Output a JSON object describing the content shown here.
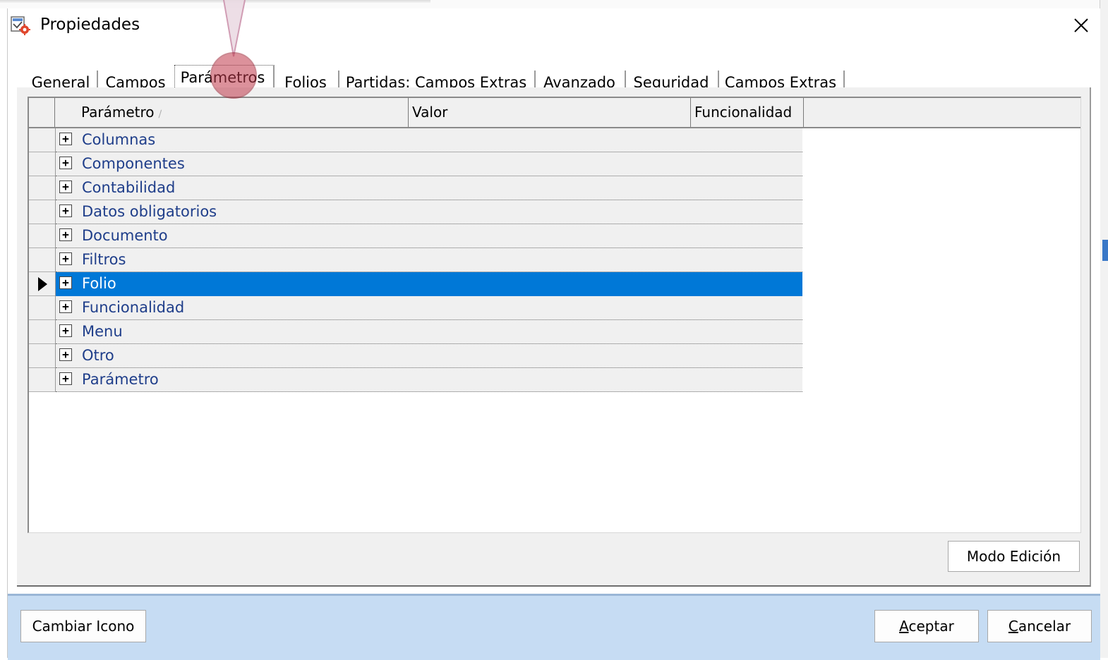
{
  "window": {
    "title": "Propiedades"
  },
  "tabs": [
    {
      "label": "General"
    },
    {
      "label": "Campos"
    },
    {
      "label": "Parámetros",
      "active": true
    },
    {
      "label": "Folios"
    },
    {
      "label": "Partidas: Campos Extras"
    },
    {
      "label": "Avanzado"
    },
    {
      "label": "Seguridad"
    },
    {
      "label": "Campos Extras"
    }
  ],
  "grid": {
    "columns": [
      {
        "label": "Parámetro",
        "sorted": "ascending"
      },
      {
        "label": "Valor"
      },
      {
        "label": "Funcionalidad"
      }
    ],
    "rows": [
      {
        "label": "Columnas"
      },
      {
        "label": "Componentes"
      },
      {
        "label": "Contabilidad"
      },
      {
        "label": "Datos obligatorios"
      },
      {
        "label": "Documento"
      },
      {
        "label": "Filtros"
      },
      {
        "label": "Folio",
        "selected": true
      },
      {
        "label": "Funcionalidad"
      },
      {
        "label": "Menu"
      },
      {
        "label": "Otro"
      },
      {
        "label": "Parámetro"
      }
    ],
    "expand_glyph": "+"
  },
  "buttons": {
    "modo_edicion": "Modo Edición",
    "cambiar_icono": "Cambiar Icono",
    "aceptar": {
      "mnemonic": "A",
      "rest": "ceptar"
    },
    "cancelar": {
      "mnemonic": "C",
      "rest": "ancelar"
    }
  },
  "colors": {
    "selection": "#0078d7",
    "footer_bg": "#c6dcf3",
    "row_text": "#1f3e8a",
    "callout": "#c0394b"
  },
  "icons": [
    "properties-app-icon",
    "close-icon",
    "expand-plus-icon",
    "current-row-arrow-icon",
    "sort-ascending-icon"
  ]
}
